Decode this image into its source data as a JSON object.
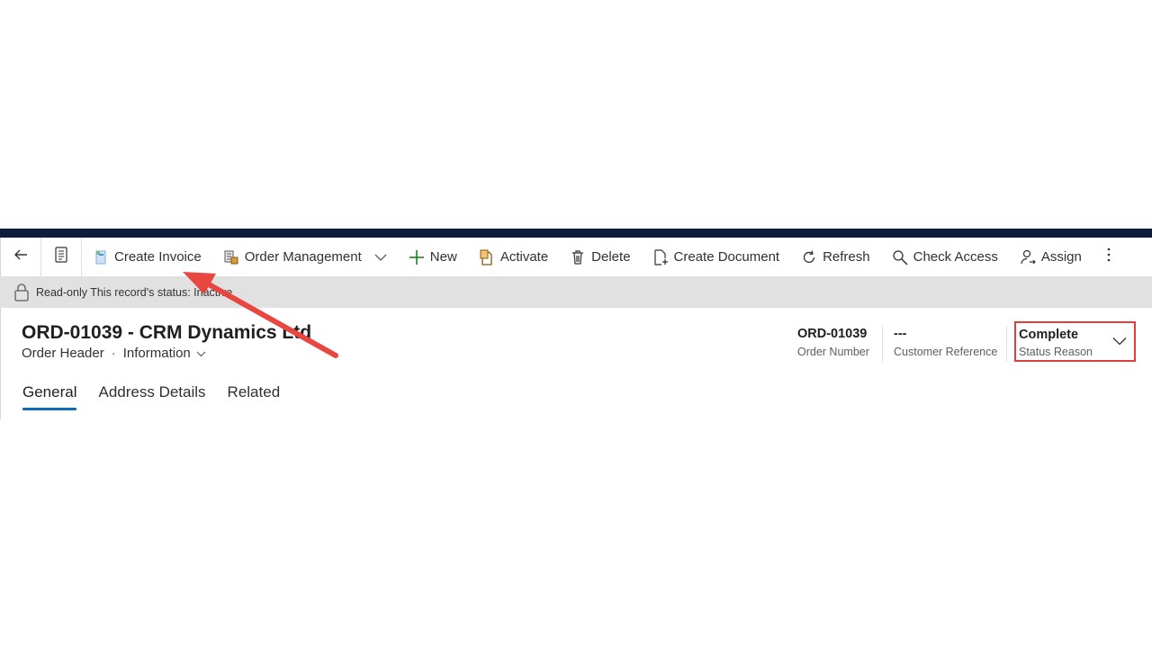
{
  "commandbar": {
    "create_invoice": "Create Invoice",
    "order_management": "Order Management",
    "new": "New",
    "activate": "Activate",
    "delete": "Delete",
    "create_document": "Create Document",
    "refresh": "Refresh",
    "check_access": "Check Access",
    "assign": "Assign"
  },
  "notice": {
    "text": "Read-only This record's status: Inactive"
  },
  "header": {
    "title": "ORD-01039 - CRM Dynamics Ltd",
    "entity": "Order Header",
    "separator": "·",
    "form": "Information",
    "fields": [
      {
        "value": "ORD-01039",
        "label": "Order Number"
      },
      {
        "value": "---",
        "label": "Customer Reference"
      }
    ],
    "status": {
      "value": "Complete",
      "label": "Status Reason"
    }
  },
  "tabs": [
    "General",
    "Address Details",
    "Related"
  ],
  "colors": {
    "topbar": "#0f1b3d",
    "accent": "#0f6cbd",
    "highlight_border": "#e03e3e",
    "annotation_arrow": "#e8473f"
  }
}
